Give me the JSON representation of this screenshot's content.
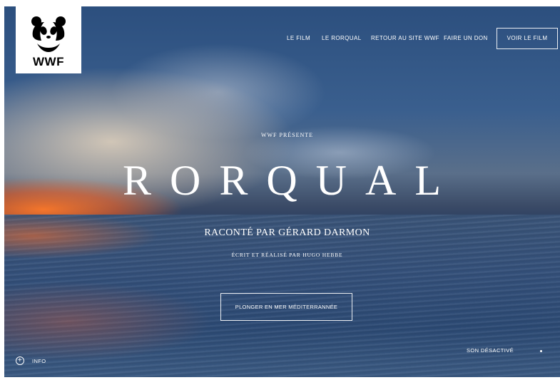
{
  "logo": {
    "text": "WWF",
    "icon": "panda-icon"
  },
  "nav": {
    "items": [
      {
        "label": "LE FILM"
      },
      {
        "label": "LE RORQUAL"
      },
      {
        "label": "RETOUR AU SITE WWF"
      },
      {
        "label": "FAIRE UN DON"
      }
    ],
    "cta_label": "VOIR LE FILM"
  },
  "hero": {
    "presents": "WWF PRÉSENTE",
    "title": "RORQUAL",
    "narrated_by": "RACONTÉ PAR GÉRARD DARMON",
    "credits": "ÉCRIT ET RÉALISÉ PAR HUGO HEBBE",
    "cta_label": "PLONGER EN MER MÉDITERRANNÉE"
  },
  "footer": {
    "info_icon": "plus-circle-icon",
    "info_label": "INFO",
    "sound_label": "SON DÉSACTIVÉ"
  },
  "colors": {
    "text": "#ffffff",
    "logo_background": "#ffffff",
    "logo_text": "#000000"
  }
}
